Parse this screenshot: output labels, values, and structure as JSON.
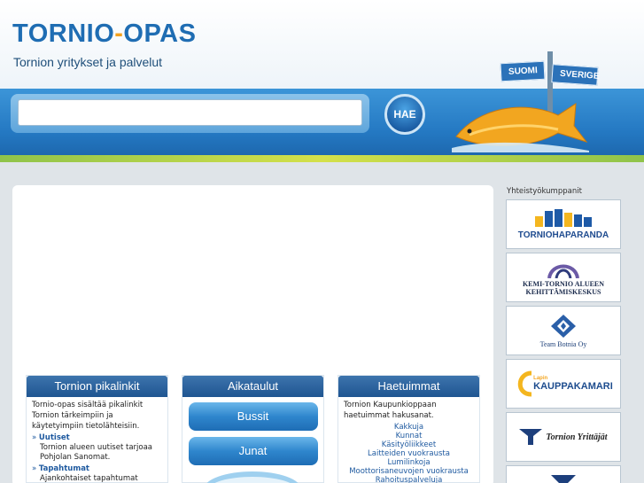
{
  "header": {
    "title_part1": "TORNIO",
    "title_dash": "-",
    "title_part2": "OPAS",
    "subtitle": "Tornion yritykset ja palvelut",
    "search": {
      "value": "",
      "button_label": "HAE"
    },
    "signs": {
      "left": "SUOMI",
      "right": "SVERIGE"
    }
  },
  "boxes": {
    "pikalinkit": {
      "title": "Tornion pikalinkit",
      "intro": "Tornio-opas sisältää pikalinkit Tornion tärkeimpiin ja käytetyimpiin tietolähteisiin.",
      "links": [
        {
          "head": "Uutiset",
          "desc": "Tornion alueen uutiset tarjoaa Pohjolan Sanomat."
        },
        {
          "head": "Tapahtumat",
          "desc": "Ajankohtaiset tapahtumat"
        }
      ]
    },
    "aikataulut": {
      "title": "Aikataulut",
      "buttons": [
        "Bussit",
        "Junat"
      ]
    },
    "haetuimmat": {
      "title": "Haetuimmat",
      "intro": "Tornion Kaupunkioppaan haetuimmat hakusanat.",
      "items": [
        "Kakkuja",
        "Kunnat",
        "Käsityöliikkeet",
        "Laitteiden vuokrausta",
        "Lumilinkoja",
        "Moottorisaneuvojen vuokrausta",
        "Rahoituspalveluja"
      ]
    }
  },
  "partners": {
    "title": "Yhteistyökumppanit",
    "items": [
      {
        "name": "TORNIOHAPARANDA",
        "part1": "TORNIO",
        "part2": "HAPARANDA"
      },
      {
        "name": "KEMI-TORNIO ALUEEN KEHITTÄMISKESKUS",
        "line1": "KEMI-TORNIO ALUEEN",
        "line2": "KEHITTÄMISKESKUS"
      },
      {
        "name": "Team Botnia Oy"
      },
      {
        "name": "Lapin KAUPPAKAMARI",
        "small": "Lapin",
        "big": "KAUPPAKAMARI"
      },
      {
        "name": "Tornion Yrittäjät"
      }
    ]
  },
  "colors": {
    "brand_blue": "#1f6db3",
    "accent_orange": "#f2a11f",
    "box_header": "#1f5591"
  }
}
